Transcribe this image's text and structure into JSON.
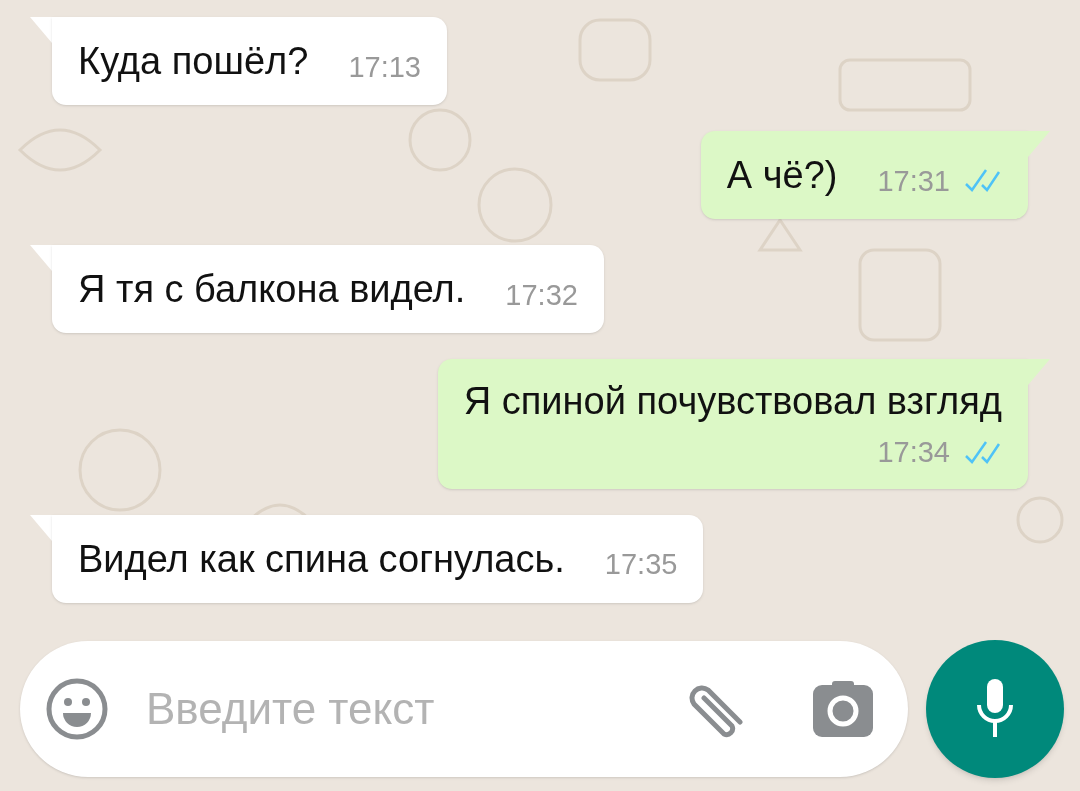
{
  "messages": [
    {
      "outgoing": false,
      "text": "Куда пошёл?",
      "time": "17:13"
    },
    {
      "outgoing": true,
      "text": "А чё?)",
      "time": "17:31",
      "read": true
    },
    {
      "outgoing": false,
      "text": "Я тя с балкона видел.",
      "time": "17:32"
    },
    {
      "outgoing": true,
      "text": "Я спиной почувствовал взгляд",
      "time": "17:34",
      "read": true,
      "time_below": true
    },
    {
      "outgoing": false,
      "text": "Видел как спина согнулась.",
      "time": "17:35"
    }
  ],
  "composer": {
    "placeholder": "Введите текст"
  }
}
